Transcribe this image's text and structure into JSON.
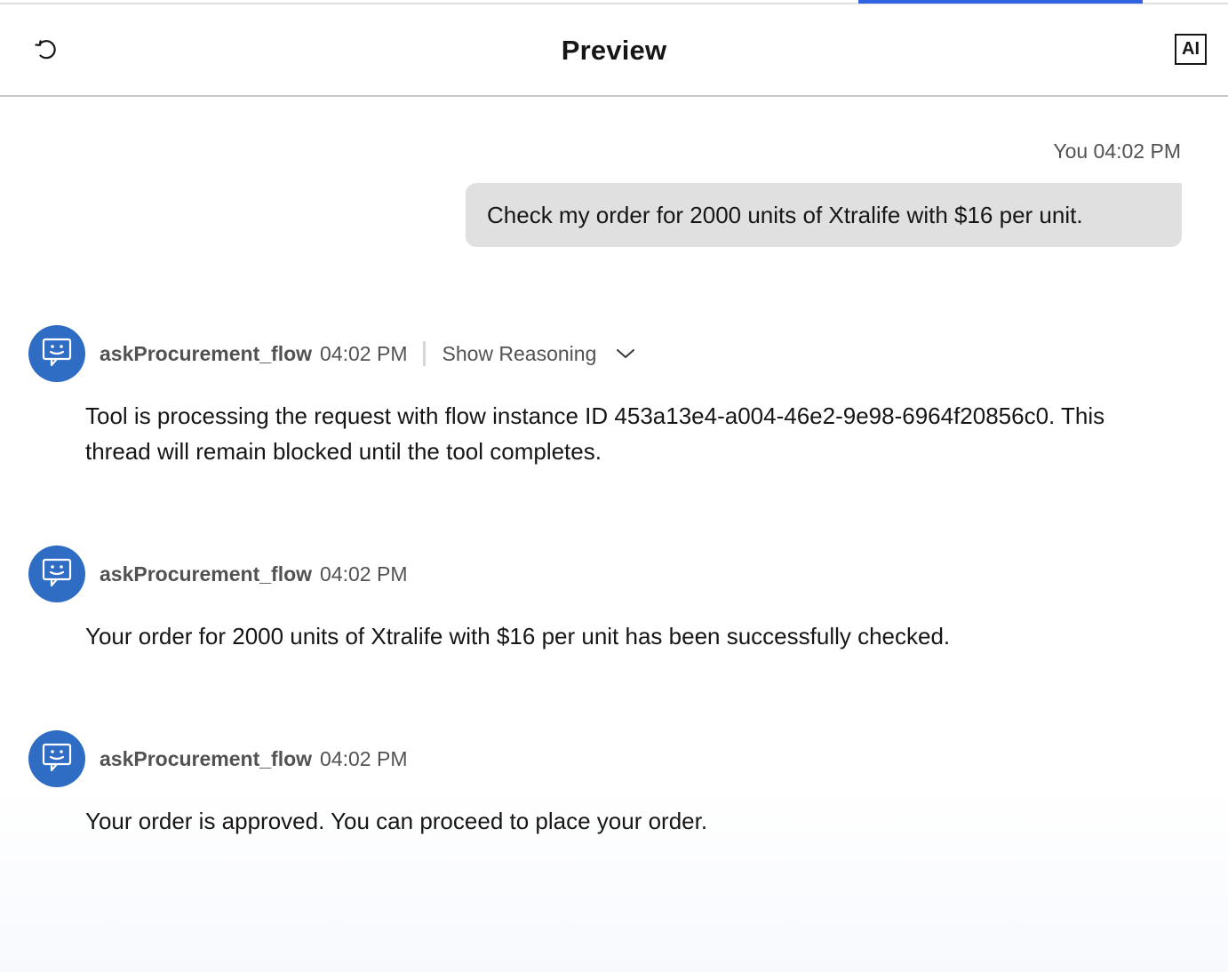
{
  "header": {
    "title": "Preview",
    "ai_label": "AI",
    "reset_icon": "reset-icon"
  },
  "user_message": {
    "author": "You",
    "time": "04:02 PM",
    "text": "Check my order for 2000 units of Xtralife with $16 per unit."
  },
  "bot_messages": [
    {
      "name": "askProcurement_flow",
      "time": "04:02 PM",
      "reasoning_label": "Show Reasoning",
      "text": "Tool is processing the request with flow instance ID 453a13e4-a004-46e2-9e98-6964f20856c0. This thread will remain blocked until the tool completes."
    },
    {
      "name": "askProcurement_flow",
      "time": "04:02 PM",
      "text": "Your order for 2000 units of Xtralife with $16 per unit has been successfully checked."
    },
    {
      "name": "askProcurement_flow",
      "time": "04:02 PM",
      "text": "Your order is approved. You can proceed to place your order."
    }
  ],
  "colors": {
    "accent": "#2f63e0",
    "avatar": "#2f6cc4",
    "user_bubble": "#e0e0e0"
  }
}
